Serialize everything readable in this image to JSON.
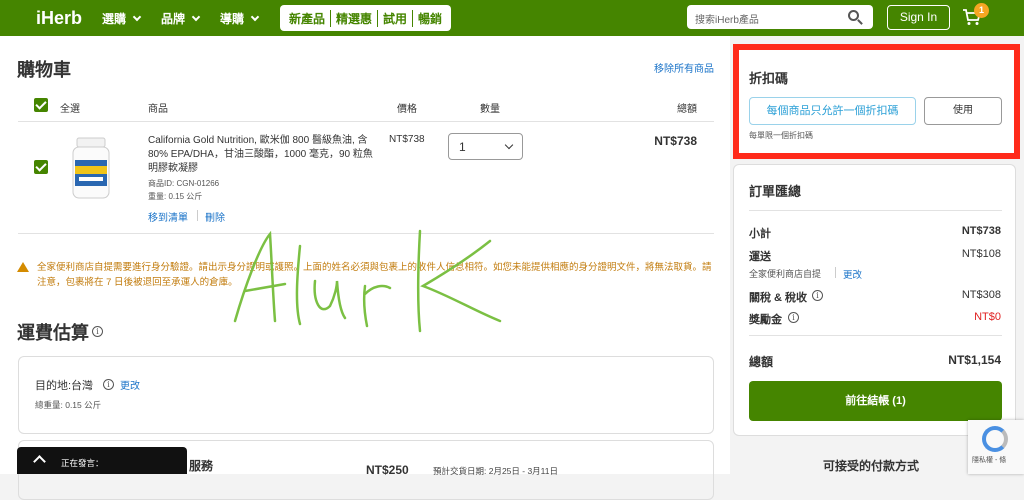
{
  "header": {
    "logo": "iHerb",
    "nav": [
      "選購",
      "品牌",
      "導購"
    ],
    "promo": [
      "新產品",
      "精選惠",
      "試用",
      "暢銷"
    ],
    "search_placeholder": "搜索iHerb產品",
    "signin": "Sign In",
    "cart_count": "1"
  },
  "cart": {
    "title": "購物車",
    "remove_all": "移除所有商品",
    "select_all": "全選",
    "col_product": "商品",
    "col_price": "價格",
    "col_qty": "數量",
    "col_total": "總額",
    "item": {
      "name": "California Gold Nutrition, 歐米伽 800 醫級魚油, 含 80% EPA/DHA，甘油三酸酯，1000 毫克，90 粒魚明膠軟凝膠",
      "product_id": "商品ID: CGN-01266",
      "weight": "重量: 0.15 公斤",
      "move_to_list": "移到清單",
      "delete": "刪除",
      "price": "NT$738",
      "qty": "1",
      "total": "NT$738"
    },
    "warning": "全家便利商店自提需要進行身分驗證。請出示身分證明或護照。上面的姓名必須與包裹上的收件人信息相符。如您未能提供相應的身分證明文件，將無法取貨。請注意，包裹將在 7 日後被退回至承運人的倉庫。",
    "signature": "Alurk"
  },
  "shipping": {
    "title": "運費估算",
    "destination_label": "目的地:台灣",
    "change": "更改",
    "total_weight": "總重量:  0.15 公斤",
    "service": "服務",
    "price": "NT$250",
    "eta": "預計交貨日期: 2月25日 - 3月11日"
  },
  "chat": {
    "label": "正在發言："
  },
  "coupon": {
    "title": "折扣碼",
    "input_text": "每個商品只允許一個折扣碼",
    "apply": "使用",
    "note": "每單限一個折扣碼"
  },
  "summary": {
    "title": "訂單匯總",
    "subtotal_label": "小計",
    "subtotal": "NT$738",
    "shipping_label": "運送",
    "shipping": "NT$108",
    "pickup": "全家便利商店自提",
    "change": "更改",
    "tax_label": "關稅 & 稅收",
    "tax": "NT$308",
    "reward_label": "獎勵金",
    "reward": "NT$0",
    "total_label": "總額",
    "total": "NT$1,154",
    "checkout": "前往結帳 (1)"
  },
  "payment": {
    "title": "可接受的付款方式"
  },
  "recaptcha": {
    "text": "隱私權 - 條"
  },
  "colors": {
    "brand": "#458500",
    "highlight": "#ff2a1a",
    "link": "#1a73c8",
    "warning": "#c27c0e",
    "reward": "#e02020"
  }
}
